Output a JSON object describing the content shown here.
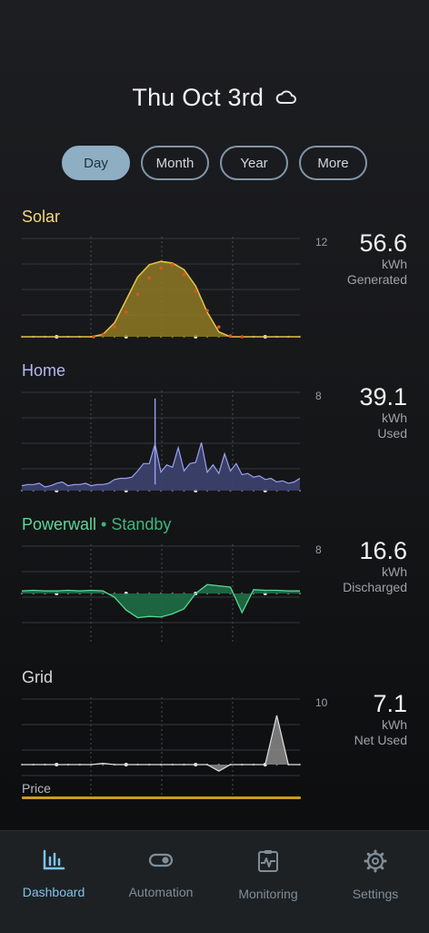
{
  "header": {
    "date": "Thu Oct 3rd",
    "weather_icon": "cloud-icon"
  },
  "tabs": [
    {
      "label": "Day",
      "active": true
    },
    {
      "label": "Month",
      "active": false
    },
    {
      "label": "Year",
      "active": false
    },
    {
      "label": "More",
      "active": false
    }
  ],
  "sections": {
    "solar": {
      "title": "Solar",
      "color": "#f4d77d",
      "scale": "12",
      "value": "56.6",
      "unit": "kWh",
      "desc": "Generated"
    },
    "home": {
      "title": "Home",
      "color": "#b6b8f2",
      "scale": "8",
      "value": "39.1",
      "unit": "kWh",
      "desc": "Used"
    },
    "powerwall": {
      "title": "Powerwall",
      "status": "• Standby",
      "color": "#5fd79a",
      "scale": "8",
      "value": "16.6",
      "unit": "kWh",
      "desc": "Discharged"
    },
    "grid": {
      "title": "Grid",
      "color": "#dcdcdc",
      "scale": "10",
      "value": "7.1",
      "unit": "kWh",
      "desc": "Net Used",
      "price_label": "Price"
    }
  },
  "colors": {
    "solar_fill": "#8f7a25",
    "solar_line": "#e6c34a",
    "forecast_dots": "#e0531f",
    "home_fill": "#3d4270",
    "home_line": "#9aa0f0",
    "powerwall_fill": "#1f6e45",
    "powerwall_line": "#56d893",
    "grid_fill": "#8a8a8a",
    "price_bar": "#d29a1c",
    "accent": "#7ec4ec"
  },
  "chart_data": [
    {
      "type": "area",
      "name": "Solar",
      "ylim": [
        0,
        12
      ],
      "x": [
        0,
        1,
        2,
        3,
        4,
        5,
        6,
        7,
        8,
        9,
        10,
        11,
        12,
        13,
        14,
        15,
        16,
        17,
        18,
        19,
        20,
        21,
        22,
        23,
        24
      ],
      "values": [
        0,
        0,
        0,
        0,
        0,
        0,
        0,
        0.3,
        1.7,
        4.5,
        7.3,
        8.8,
        9.2,
        9.0,
        8.2,
        6.2,
        3.0,
        0.6,
        0,
        0,
        0,
        0,
        0,
        0,
        0
      ]
    },
    {
      "type": "line",
      "name": "Home",
      "ylim": [
        0,
        8
      ],
      "x": [
        0,
        1,
        2,
        3,
        4,
        5,
        6,
        7,
        8,
        9,
        10,
        11,
        12,
        13,
        14,
        15,
        16,
        17,
        18,
        19,
        20,
        21,
        22,
        23,
        24
      ],
      "values": [
        0.4,
        0.5,
        0.3,
        0.6,
        0.4,
        0.5,
        0.4,
        0.5,
        0.9,
        1.0,
        1.6,
        2.2,
        1.5,
        1.9,
        1.6,
        2.3,
        1.5,
        1.4,
        1.6,
        1.3,
        1.1,
        0.9,
        0.7,
        0.6,
        1.0
      ]
    },
    {
      "type": "line",
      "name": "Powerwall",
      "ylim": [
        -8,
        8
      ],
      "x": [
        0,
        1,
        2,
        3,
        4,
        5,
        6,
        7,
        8,
        9,
        10,
        11,
        12,
        13,
        14,
        15,
        16,
        17,
        18,
        19,
        20,
        21,
        22,
        23,
        24
      ],
      "values": [
        0.4,
        0.5,
        0.4,
        0.4,
        0.5,
        0.4,
        0.5,
        0.4,
        -0.6,
        -2.6,
        -3.8,
        -3.6,
        -3.7,
        -3.2,
        -2.4,
        0,
        1.4,
        1.2,
        1.0,
        -3.0,
        0.6,
        0.5,
        0.5,
        0.4,
        0.4
      ]
    },
    {
      "type": "line",
      "name": "Grid",
      "ylim": [
        -10,
        10
      ],
      "x": [
        0,
        1,
        2,
        3,
        4,
        5,
        6,
        7,
        8,
        9,
        10,
        11,
        12,
        13,
        14,
        15,
        16,
        17,
        18,
        19,
        20,
        21,
        22,
        23,
        24
      ],
      "values": [
        0,
        0,
        0,
        0,
        0,
        0,
        0,
        0.2,
        0,
        0,
        0,
        0,
        0,
        0,
        0,
        0,
        0,
        -1.0,
        0,
        0,
        0,
        0,
        7.5,
        0,
        0
      ]
    }
  ],
  "nav": [
    {
      "label": "Dashboard",
      "icon": "bar-chart-icon",
      "active": true
    },
    {
      "label": "Automation",
      "icon": "toggle-icon",
      "active": false
    },
    {
      "label": "Monitoring",
      "icon": "clipboard-pulse-icon",
      "active": false
    },
    {
      "label": "Settings",
      "icon": "gear-icon",
      "active": false
    }
  ]
}
